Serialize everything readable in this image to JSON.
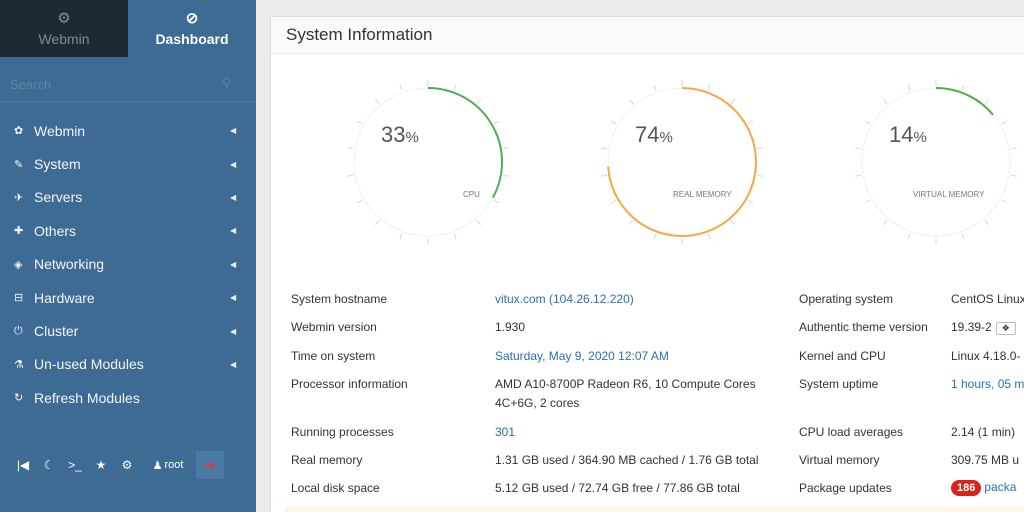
{
  "sidebar": {
    "tabs": [
      {
        "label": "Webmin",
        "icon": "⚙"
      },
      {
        "label": "Dashboard",
        "icon": "⊘"
      }
    ],
    "search": {
      "placeholder": "Search"
    },
    "items": [
      {
        "label": "Webmin",
        "icon": "✿"
      },
      {
        "label": "System",
        "icon": "✎"
      },
      {
        "label": "Servers",
        "icon": "✈"
      },
      {
        "label": "Others",
        "icon": "✚"
      },
      {
        "label": "Networking",
        "icon": "◈"
      },
      {
        "label": "Hardware",
        "icon": "⊟"
      },
      {
        "label": "Cluster",
        "icon": "⏻"
      },
      {
        "label": "Un-used Modules",
        "icon": "⚗"
      },
      {
        "label": "Refresh Modules",
        "icon": "↻"
      }
    ],
    "bottom": {
      "user": "root"
    }
  },
  "panel": {
    "title": "System Information"
  },
  "gauges": [
    {
      "value": "33",
      "unit": "%",
      "label": "CPU",
      "percent": 33,
      "color": "#4caf50"
    },
    {
      "value": "74",
      "unit": "%",
      "label": "REAL MEMORY",
      "percent": 74,
      "color": "#f5a742"
    },
    {
      "value": "14",
      "unit": "%",
      "label": "VIRTUAL MEMORY",
      "percent": 14,
      "color": "#4caf50"
    }
  ],
  "info": {
    "left": [
      {
        "label": "System hostname",
        "value": "vitux.com (104.26.12.220)",
        "value2": ""
      },
      {
        "label": "Webmin version",
        "value": "1.930",
        "value2": ""
      },
      {
        "label": "Time on system",
        "value": "Saturday, May 9, 2020 12:07 AM",
        "value2": ""
      },
      {
        "label": "Processor information",
        "value": "AMD A10-8700P Radeon R6, 10 Compute Cores",
        "value2": "4C+6G, 2 cores"
      },
      {
        "label": "Running processes",
        "value": "301",
        "value2": ""
      },
      {
        "label": "Real memory",
        "value": "1.31 GB used / 364.90 MB cached / 1.76 GB total",
        "value2": ""
      },
      {
        "label": "Local disk space",
        "value": "5.12 GB used / 72.74 GB free / 77.86 GB total",
        "value2": ""
      }
    ],
    "right": [
      {
        "label": "Operating system",
        "value": "CentOS Linux"
      },
      {
        "label": "Authentic theme version",
        "value": "19.39-2"
      },
      {
        "label": "Kernel and CPU",
        "value": "Linux 4.18.0-"
      },
      {
        "label": "System uptime",
        "value": "1 hours, 05 m"
      },
      {
        "label": "CPU load averages",
        "value": "2.14 (1 min) "
      },
      {
        "label": "Virtual memory",
        "value": "309.75 MB u"
      },
      {
        "label": "Package updates",
        "value": "packa",
        "badge": "186"
      }
    ]
  }
}
